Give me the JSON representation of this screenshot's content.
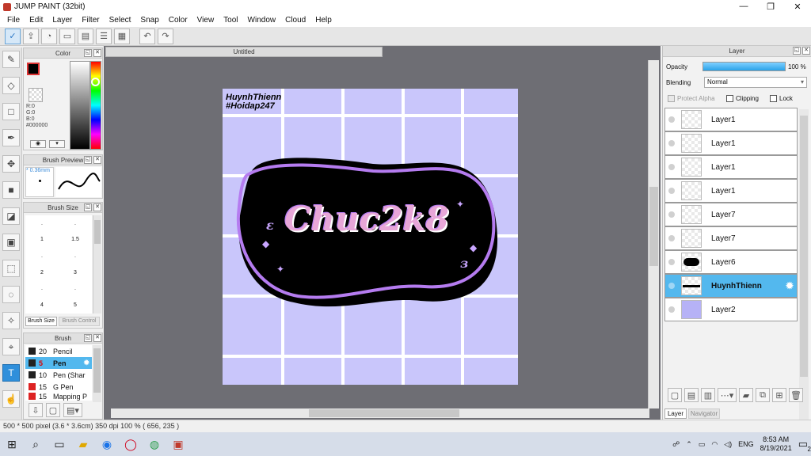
{
  "window": {
    "title": "JUMP PAINT (32bit)",
    "min": "—",
    "max": "❐",
    "close": "✕"
  },
  "menu": [
    "File",
    "Edit",
    "Layer",
    "Filter",
    "Select",
    "Snap",
    "Color",
    "View",
    "Tool",
    "Window",
    "Cloud",
    "Help"
  ],
  "color_panel": {
    "title": "Color",
    "r": "R:0",
    "g": "G:0",
    "b": "B:0",
    "hex": "#000000"
  },
  "brush_preview": {
    "title": "Brush Preview",
    "size": "* 0.36mm"
  },
  "brush_size": {
    "title": "Brush Size",
    "labels": [
      ".",
      ".",
      "1",
      "1.5",
      ".",
      ".",
      "2",
      "3",
      ".",
      ".",
      "4",
      "5"
    ],
    "tab1": "Brush Size",
    "tab2": "Brush Control"
  },
  "brush_list": {
    "title": "Brush",
    "items": [
      {
        "size": "20",
        "name": "Pencil",
        "selected": false
      },
      {
        "size": "5",
        "name": "Pen",
        "selected": true
      },
      {
        "size": "10",
        "name": "Pen (Shar",
        "selected": false
      },
      {
        "size": "15",
        "name": "G Pen",
        "selected": false
      },
      {
        "size": "15",
        "name": "Mapping P",
        "selected": false
      }
    ]
  },
  "document": {
    "tab": "Untitled",
    "watermark_line1": "HuynhThienn",
    "watermark_line2": "#Hoidap247",
    "art_text": "Chuc2k8"
  },
  "layer_panel": {
    "title": "Layer",
    "opacity_label": "Opacity",
    "opacity_value": "100 %",
    "blending_label": "Blending",
    "blending_value": "Normal",
    "protect_alpha": "Protect Alpha",
    "clipping": "Clipping",
    "lock": "Lock",
    "layers": [
      {
        "name": "Layer1",
        "selected": false
      },
      {
        "name": "Layer1",
        "selected": false
      },
      {
        "name": "Layer1",
        "selected": false
      },
      {
        "name": "Layer1",
        "selected": false
      },
      {
        "name": "Layer7",
        "selected": false
      },
      {
        "name": "Layer7",
        "selected": false
      },
      {
        "name": "Layer6",
        "selected": false
      },
      {
        "name": "HuynhThienn",
        "selected": true
      },
      {
        "name": "Layer2",
        "selected": false
      }
    ],
    "tab_layer": "Layer",
    "tab_navigator": "Navigator"
  },
  "status": "500 * 500 pixel  (3.6 * 3.6cm)  350 dpi  100 %  ( 656, 235 )",
  "taskbar": {
    "lang": "ENG",
    "time": "8:53 AM",
    "date": "8/19/2021",
    "notif": "2"
  },
  "colors": {
    "accent": "#2f8fdb",
    "selected_layer": "#53b8ee",
    "canvas_bg": "#c9c6fb",
    "blob": "#000000",
    "outline": "#b57cf0"
  }
}
